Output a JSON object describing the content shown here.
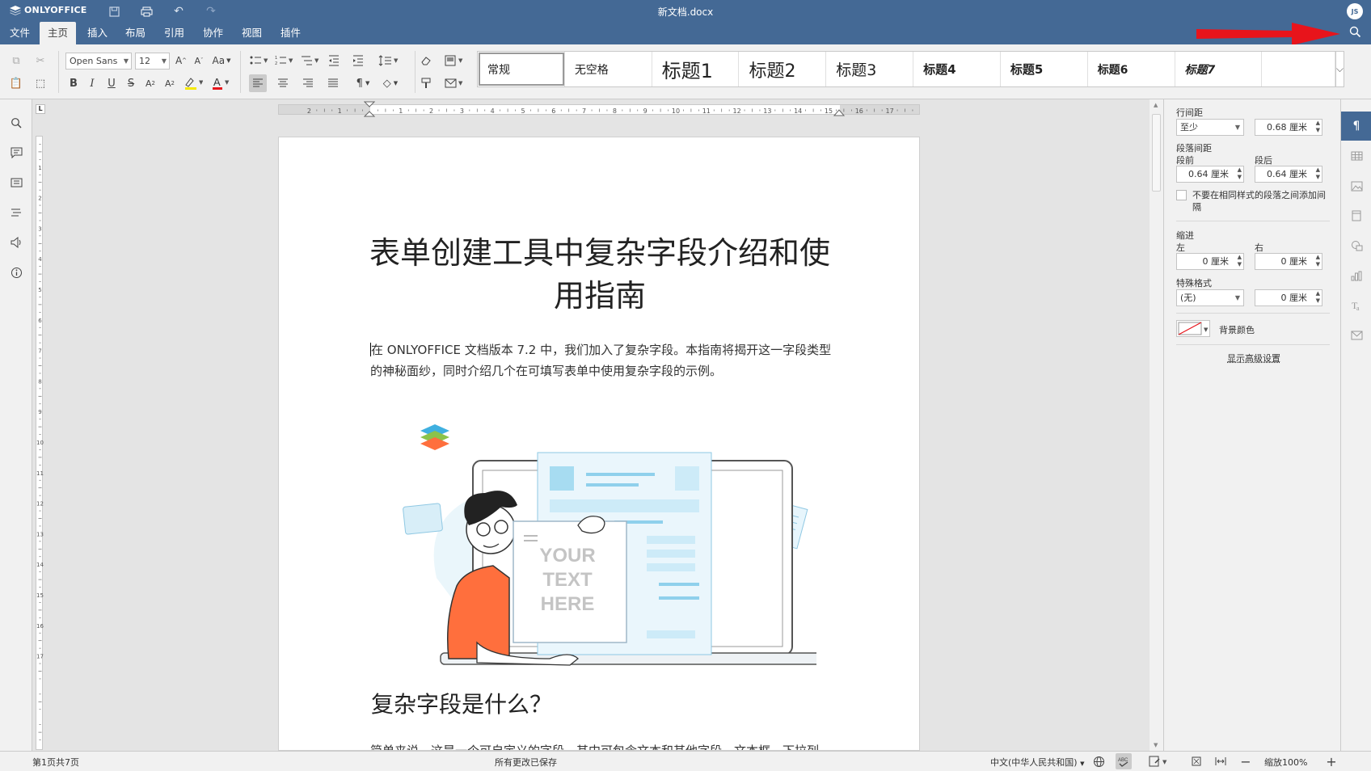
{
  "app": {
    "brand": "ONLYOFFICE",
    "doc_title": "新文档.docx",
    "user_initials": "JS"
  },
  "tabs": [
    "文件",
    "主页",
    "插入",
    "布局",
    "引用",
    "协作",
    "视图",
    "插件"
  ],
  "active_tab": "主页",
  "toolbar": {
    "font_name": "Open Sans",
    "font_size": "12",
    "change_case": "Aa",
    "styles": [
      "常规",
      "无空格",
      "标题1",
      "标题2",
      "标题3",
      "标题4",
      "标题5",
      "标题6",
      "标题7"
    ],
    "selected_style": "常规"
  },
  "ruler": {
    "h_ticks": [
      "2",
      "1",
      "1",
      "2",
      "3",
      "4",
      "5",
      "6",
      "7",
      "8",
      "9",
      "10",
      "11",
      "12",
      "13",
      "14",
      "15",
      "16",
      "17"
    ],
    "v_ticks": [
      "1",
      "2",
      "3",
      "4",
      "5",
      "6",
      "7",
      "8",
      "9",
      "10",
      "11",
      "12",
      "13",
      "14",
      "15",
      "16",
      "17"
    ],
    "corner": "L"
  },
  "document": {
    "title": "表单创建工具中复杂字段介绍和使用指南",
    "title_line1": "表单创建工具中复杂字段介绍和使",
    "title_line2": "用指南",
    "intro": "在 ONLYOFFICE 文档版本 7.2 中，我们加入了复杂字段。本指南将揭开这一字段类型的神秘面纱，同时介绍几个在可填写表单中使用复杂字段的示例。",
    "intro_first_char": "在",
    "intro_rest": " ONLYOFFICE 文档版本 7.2 中，我们加入了复杂字段。本指南将揭开这一字段类型的神秘面纱，同时介绍几个在可填写表单中使用复杂字段的示例。",
    "illustration_text": [
      "YOUR",
      "TEXT",
      "HERE"
    ],
    "heading2": "复杂字段是什么？",
    "para2_visible": "简单来说，这是一个可自定义的字段，其中可包含文本和其他字段，文本框、下拉列"
  },
  "paragraph_panel": {
    "line_spacing_label": "行间距",
    "line_spacing_mode": "至少",
    "line_spacing_value": "0.68 厘米",
    "paragraph_spacing_label": "段落间距",
    "before_label": "段前",
    "after_label": "段后",
    "before_value": "0.64 厘米",
    "after_value": "0.64 厘米",
    "no_space_same_style": "不要在相同样式的段落之间添加间隔",
    "indent_label": "缩进",
    "left_label": "左",
    "right_label": "右",
    "left_value": "0 厘米",
    "right_value": "0 厘米",
    "special_label": "特殊格式",
    "special_mode": "(无)",
    "special_value": "0 厘米",
    "background_color_label": "背景颜色",
    "advanced_link": "显示高级设置"
  },
  "statusbar": {
    "page_info": "第1页共7页",
    "save_status": "所有更改已保存",
    "language": "中文(中华人民共和国)",
    "zoom": "缩放100%"
  },
  "colors": {
    "header_blue": "#446995",
    "annotation_arrow": "#e8141b",
    "illustration_orange": "#ff6f3d",
    "illustration_blue": "#8fd0ec"
  }
}
